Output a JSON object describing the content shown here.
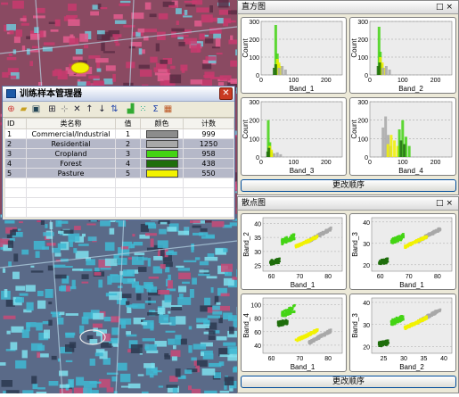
{
  "dialog": {
    "title": "训练样本管理器",
    "columns": [
      "ID",
      "类名称",
      "值",
      "颜色",
      "计数"
    ],
    "rows": [
      {
        "id": "1",
        "name": "Commercial/Industrial",
        "value": "1",
        "color": "#8c8c8c",
        "count": "999"
      },
      {
        "id": "2",
        "name": "Residential",
        "value": "2",
        "color": "#a8a8a8",
        "count": "1250"
      },
      {
        "id": "3",
        "name": "Cropland",
        "value": "3",
        "color": "#44d414",
        "count": "958"
      },
      {
        "id": "4",
        "name": "Forest",
        "value": "4",
        "color": "#1f6e0c",
        "count": "438"
      },
      {
        "id": "5",
        "name": "Pasture",
        "value": "5",
        "color": "#f2f200",
        "count": "550"
      }
    ],
    "toolbar_icons": [
      "merge-icon",
      "open-icon",
      "save-icon",
      "split-icon",
      "split-alt-icon",
      "delete-icon",
      "move-up-icon",
      "move-down-icon",
      "sort-icon",
      "histogram-icon",
      "scatter-icon",
      "sigma-icon",
      "evaluate-icon"
    ]
  },
  "histogram_panel": {
    "title": "直方图",
    "order_button": "更改顺序",
    "controls": [
      "□",
      "×"
    ]
  },
  "scatter_panel": {
    "title": "散点图",
    "order_button": "更改顺序",
    "controls": [
      "□",
      "×"
    ]
  },
  "chart_data": [
    {
      "type": "bar",
      "title": "",
      "xlabel": "Band_1",
      "ylabel": "Count",
      "ylim": [
        0,
        300
      ],
      "xlim": [
        0,
        250
      ],
      "yticks": [
        "0",
        "100",
        "200",
        "300"
      ],
      "xticks": [
        "0",
        "100",
        "200"
      ],
      "series": [
        {
          "name": "Cropland",
          "color": "#44d414",
          "x": [
            45,
            50,
            55
          ],
          "values": [
            280,
            120,
            60
          ]
        },
        {
          "name": "Pasture",
          "color": "#f2f200",
          "x": [
            50,
            55,
            60
          ],
          "values": [
            90,
            70,
            50
          ]
        },
        {
          "name": "Forest",
          "color": "#1f6e0c",
          "x": [
            40,
            45
          ],
          "values": [
            40,
            60
          ]
        },
        {
          "name": "Residential",
          "color": "#a8a8a8",
          "x": [
            55,
            65,
            75
          ],
          "values": [
            40,
            50,
            30
          ]
        }
      ]
    },
    {
      "type": "bar",
      "title": "",
      "xlabel": "Band_2",
      "ylabel": "Count",
      "ylim": [
        0,
        300
      ],
      "xlim": [
        0,
        250
      ],
      "yticks": [
        "0",
        "100",
        "200",
        "300"
      ],
      "xticks": [
        "0",
        "100",
        "200"
      ],
      "series": [
        {
          "name": "Cropland",
          "color": "#44d414",
          "x": [
            28,
            32,
            36
          ],
          "values": [
            270,
            130,
            60
          ]
        },
        {
          "name": "Pasture",
          "color": "#f2f200",
          "x": [
            32,
            38,
            44
          ],
          "values": [
            100,
            70,
            40
          ]
        },
        {
          "name": "Forest",
          "color": "#1f6e0c",
          "x": [
            25,
            30
          ],
          "values": [
            50,
            70
          ]
        },
        {
          "name": "Residential",
          "color": "#a8a8a8",
          "x": [
            40,
            50,
            60
          ],
          "values": [
            40,
            50,
            30
          ]
        }
      ]
    },
    {
      "type": "bar",
      "title": "",
      "xlabel": "Band_3",
      "ylabel": "Count",
      "ylim": [
        0,
        300
      ],
      "xlim": [
        0,
        250
      ],
      "yticks": [
        "0",
        "100",
        "200",
        "300"
      ],
      "xticks": [
        "0",
        "100",
        "200"
      ],
      "series": [
        {
          "name": "Cropland",
          "color": "#44d414",
          "x": [
            22,
            27,
            32
          ],
          "values": [
            200,
            80,
            30
          ]
        },
        {
          "name": "Pasture",
          "color": "#f2f200",
          "x": [
            27,
            32,
            38
          ],
          "values": [
            60,
            40,
            20
          ]
        },
        {
          "name": "Forest",
          "color": "#1f6e0c",
          "x": [
            20,
            24
          ],
          "values": [
            30,
            50
          ]
        },
        {
          "name": "Residential",
          "color": "#a8a8a8",
          "x": [
            40,
            50,
            60
          ],
          "values": [
            20,
            25,
            15
          ]
        }
      ]
    },
    {
      "type": "bar",
      "title": "",
      "xlabel": "Band_4",
      "ylabel": "Count",
      "ylim": [
        0,
        300
      ],
      "xlim": [
        0,
        250
      ],
      "yticks": [
        "0",
        "100",
        "200",
        "300"
      ],
      "xticks": [
        "0",
        "100",
        "200"
      ],
      "series": [
        {
          "name": "Residential",
          "color": "#a8a8a8",
          "x": [
            40,
            48,
            56,
            64
          ],
          "values": [
            160,
            220,
            120,
            60
          ]
        },
        {
          "name": "Pasture",
          "color": "#f2f200",
          "x": [
            55,
            65,
            75,
            85
          ],
          "values": [
            70,
            120,
            90,
            60
          ]
        },
        {
          "name": "Cropland",
          "color": "#44d414",
          "x": [
            90,
            100,
            110,
            120
          ],
          "values": [
            150,
            200,
            110,
            60
          ]
        },
        {
          "name": "Forest",
          "color": "#1f6e0c",
          "x": [
            95,
            105
          ],
          "values": [
            90,
            70
          ]
        }
      ]
    },
    {
      "type": "scatter",
      "title": "",
      "xlabel": "Band_1",
      "ylabel": "Band_2",
      "xlim": [
        57,
        85
      ],
      "ylim": [
        23,
        42
      ],
      "xticks": [
        "60",
        "70",
        "80"
      ],
      "yticks": [
        "25",
        "30",
        "35",
        "40"
      ]
    },
    {
      "type": "scatter",
      "title": "",
      "xlabel": "Band_1",
      "ylabel": "Band_3",
      "xlim": [
        57,
        85
      ],
      "ylim": [
        17,
        42
      ],
      "xticks": [
        "60",
        "70",
        "80"
      ],
      "yticks": [
        "20",
        "30",
        "40"
      ]
    },
    {
      "type": "scatter",
      "title": "",
      "xlabel": "Band_1",
      "ylabel": "Band_4",
      "xlim": [
        57,
        85
      ],
      "ylim": [
        28,
        110
      ],
      "xticks": [
        "60",
        "70",
        "80"
      ],
      "yticks": [
        "40",
        "60",
        "80",
        "100"
      ]
    },
    {
      "type": "scatter",
      "title": "",
      "xlabel": "Band_2",
      "ylabel": "Band_3",
      "xlim": [
        22,
        42
      ],
      "ylim": [
        17,
        42
      ],
      "xticks": [
        "25",
        "30",
        "35",
        "40"
      ],
      "yticks": [
        "20",
        "30",
        "40"
      ]
    }
  ]
}
